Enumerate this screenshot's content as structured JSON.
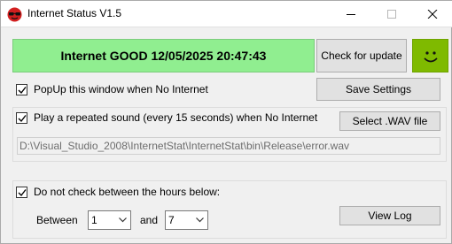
{
  "window": {
    "title": "Internet Status V1.5"
  },
  "status": {
    "text": "Internet GOOD 12/05/2025 20:47:43",
    "color": "#90ee90"
  },
  "buttons": {
    "check_update": "Check for update",
    "save_settings": "Save Settings",
    "select_wav": "Select .WAV file",
    "view_log": "View Log"
  },
  "smiley": {
    "icon": "smiley-face-icon",
    "color": "#7fba00"
  },
  "options": {
    "popup": {
      "label": "PopUp this window when No Internet",
      "checked": true
    },
    "sound": {
      "label": "Play a repeated sound (every 15 seconds) when No Internet",
      "checked": true
    },
    "wav_path": "D:\\Visual_Studio_2008\\InternetStat\\InternetStat\\bin\\Release\\error.wav",
    "hours": {
      "label": "Do not check between the hours below:",
      "checked": true
    }
  },
  "hours": {
    "between_label": "Between",
    "and_label": "and",
    "from_value": "1",
    "to_value": "7"
  }
}
